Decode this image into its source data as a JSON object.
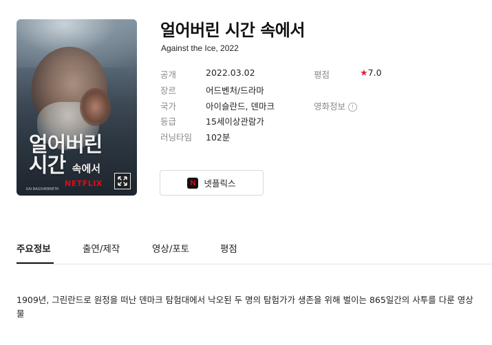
{
  "movie": {
    "title": "얼어버린 시간 속에서",
    "subtitle": "Against the Ice, 2022"
  },
  "poster": {
    "title_line1": "얼어버린",
    "title_line2": "시간",
    "title_small": "속에서",
    "brand": "NETFLIX",
    "credit": "KAI BAGSHEBNETH",
    "expand_icon": "expand-icon"
  },
  "details": [
    {
      "label": "공개",
      "value": "2022.03.02"
    },
    {
      "label": "장르",
      "value": "어드벤처/드라마"
    },
    {
      "label": "국가",
      "value": "아이슬란드, 덴마크"
    },
    {
      "label": "등급",
      "value": "15세이상관람가"
    },
    {
      "label": "러닝타임",
      "value": "102분"
    }
  ],
  "rating": {
    "label": "평점",
    "value": "7.0"
  },
  "movie_info": {
    "label": "영화정보"
  },
  "watch": {
    "label": "넷플릭스",
    "icon_letter": "N",
    "accent": "#e50914"
  },
  "tabs": [
    {
      "label": "주요정보",
      "active": true
    },
    {
      "label": "출연/제작",
      "active": false
    },
    {
      "label": "영상/포토",
      "active": false
    },
    {
      "label": "평점",
      "active": false
    }
  ],
  "synopsis": "1909년, 그린란드로 원정을 떠난 덴마크 탐험대에서 낙오된 두 명의 탐험가가 생존을 위해 벌이는 865일간의 사투를 다룬 영상물"
}
